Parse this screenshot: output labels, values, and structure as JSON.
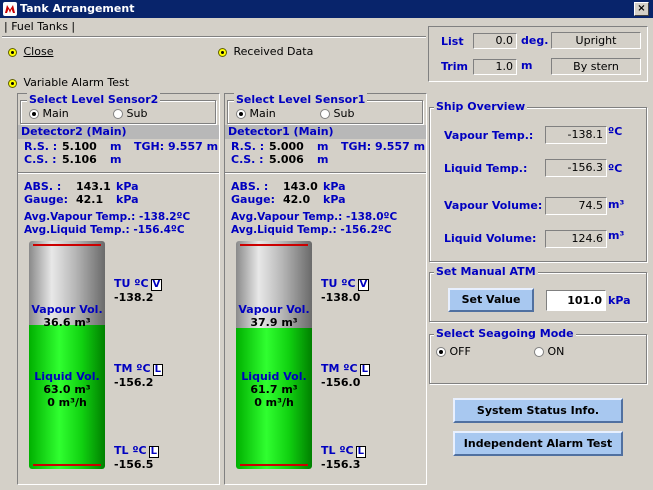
{
  "window": {
    "title": "Tank Arrangement",
    "close_glyph": "×"
  },
  "menu": {
    "item": "| Fuel Tanks |"
  },
  "controls": {
    "close": "Close",
    "received_data": "Received Data",
    "variable_alarm_test": "Variable Alarm Test"
  },
  "attitude": {
    "list_label": "List",
    "list_value": "0.0",
    "list_unit": "deg.",
    "list_state": "Upright",
    "trim_label": "Trim",
    "trim_value": "1.0",
    "trim_unit": "m",
    "trim_state": "By stern"
  },
  "tanks": [
    {
      "sensor_title": "Select Level Sensor2",
      "opt_main": "Main",
      "opt_sub": "Sub",
      "detector": "Detector2 (Main)",
      "rs_label": "R.S. :",
      "rs_value": "5.100",
      "rs_unit": "m",
      "tgh": "TGH: 9.557 m",
      "cs_label": "C.S. :",
      "cs_value": "5.106",
      "cs_unit": "m",
      "abs_label": "ABS. :",
      "abs_value": "143.1",
      "abs_unit": "kPa",
      "gauge_label": "Gauge:",
      "gauge_value": "42.1",
      "gauge_unit": "kPa",
      "avg_vapour": "Avg.Vapour Temp.: -138.2ºC",
      "avg_liquid": "Avg.Liquid Temp.: -156.4ºC",
      "vapour_label": "Vapour Vol.",
      "vapour_value": "36.6 m³",
      "liquid_label": "Liquid Vol.",
      "liquid_value": "63.0 m³",
      "flow": "0 m³/h",
      "level_fraction": 0.63,
      "tu_label": "TU ºC",
      "tu_tag": "V",
      "tu_value": "-138.2",
      "tm_label": "TM ºC",
      "tm_tag": "L",
      "tm_value": "-156.2",
      "tl_label": "TL ºC",
      "tl_tag": "L",
      "tl_value": "-156.5"
    },
    {
      "sensor_title": "Select Level Sensor1",
      "opt_main": "Main",
      "opt_sub": "Sub",
      "detector": "Detector1 (Main)",
      "rs_label": "R.S. :",
      "rs_value": "5.000",
      "rs_unit": "m",
      "tgh": "TGH: 9.557 m",
      "cs_label": "C.S. :",
      "cs_value": "5.006",
      "cs_unit": "m",
      "abs_label": "ABS. :",
      "abs_value": "143.0",
      "abs_unit": "kPa",
      "gauge_label": "Gauge:",
      "gauge_value": "42.0",
      "gauge_unit": "kPa",
      "avg_vapour": "Avg.Vapour Temp.: -138.0ºC",
      "avg_liquid": "Avg.Liquid Temp.: -156.2ºC",
      "vapour_label": "Vapour Vol.",
      "vapour_value": "37.9 m³",
      "liquid_label": "Liquid Vol.",
      "liquid_value": "61.7 m³",
      "flow": "0 m³/h",
      "level_fraction": 0.62,
      "tu_label": "TU ºC",
      "tu_tag": "V",
      "tu_value": "-138.0",
      "tm_label": "TM ºC",
      "tm_tag": "L",
      "tm_value": "-156.0",
      "tl_label": "TL ºC",
      "tl_tag": "L",
      "tl_value": "-156.3"
    }
  ],
  "ship_overview": {
    "title": "Ship Overview",
    "vapour_temp_label": "Vapour Temp.:",
    "vapour_temp_value": "-138.1",
    "vapour_temp_unit": "ºC",
    "liquid_temp_label": "Liquid Temp.:",
    "liquid_temp_value": "-156.3",
    "liquid_temp_unit": "ºC",
    "vapour_vol_label": "Vapour Volume:",
    "vapour_vol_value": "74.5",
    "vapour_vol_unit": "m³",
    "liquid_vol_label": "Liquid Volume:",
    "liquid_vol_value": "124.6",
    "liquid_vol_unit": "m³"
  },
  "manual_atm": {
    "title": "Set Manual ATM",
    "button": "Set Value",
    "value": "101.0",
    "unit": "kPa"
  },
  "seagoing": {
    "title": "Select Seagoing Mode",
    "off": "OFF",
    "on": "ON"
  },
  "buttons": {
    "system_status": "System Status Info.",
    "independent_alarm": "Independent Alarm Test"
  }
}
